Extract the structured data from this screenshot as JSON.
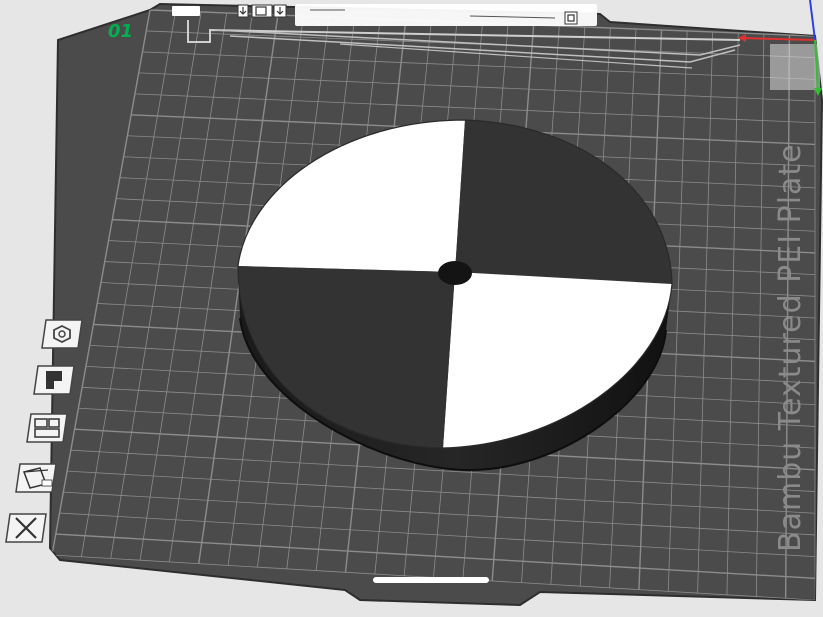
{
  "viewport": {
    "plate_name": "Bambu Textured PEI Plate",
    "plate_index": "01",
    "background_color": "#e6e6e6",
    "plate_color": "#4b4b4b",
    "grid_color": "#9a9a9a",
    "axis_colors": {
      "x": "#e03030",
      "y": "#30c030",
      "z": "#3040e0"
    }
  },
  "model": {
    "name": "calibration-target-disc",
    "quadrant_colors": [
      "#ffffff",
      "#333333",
      "#ffffff",
      "#333333"
    ]
  },
  "plate_toolbar": {
    "icons": [
      "arrange-icon",
      "orient-icon",
      "layout-icon",
      "lock-icon"
    ]
  },
  "side_toolbar": {
    "items": [
      {
        "icon": "auto-orient-icon"
      },
      {
        "icon": "filament-icon"
      },
      {
        "icon": "arrange-plate-icon"
      },
      {
        "icon": "settings-plate-icon"
      },
      {
        "icon": "delete-plate-icon"
      }
    ]
  }
}
